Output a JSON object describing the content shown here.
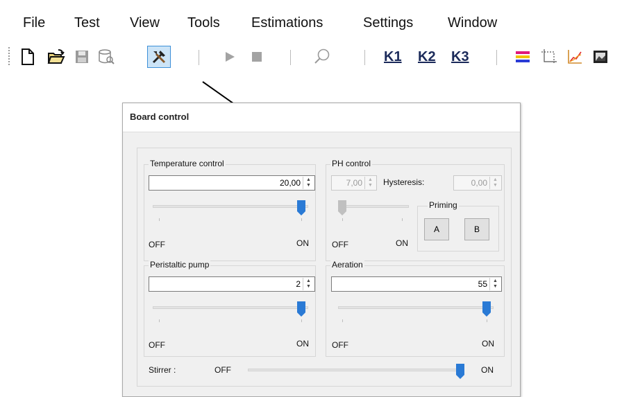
{
  "menu": [
    "File",
    "Test",
    "View",
    "Tools",
    "Estimations",
    "Settings",
    "Window"
  ],
  "toolbar": {
    "icons": [
      "new-file-icon",
      "open-folder-icon",
      "save-icon",
      "database-icon",
      "tools-icon",
      "play-icon",
      "stop-icon",
      "search-icon",
      "color-bars-icon",
      "selection-icon",
      "chart-icon",
      "image-icon"
    ],
    "k_buttons": [
      "K1",
      "K2",
      "K3"
    ]
  },
  "dialog": {
    "title": "Board control",
    "temperature": {
      "label": "Temperature control",
      "value": "20,00",
      "off": "OFF",
      "on": "ON",
      "level": 1.0
    },
    "ph": {
      "label": "PH control",
      "value": "7,00",
      "hysteresis_label": "Hysteresis:",
      "hysteresis_value": "0,00",
      "off": "OFF",
      "on": "ON",
      "level": 0.0
    },
    "priming": {
      "label": "Priming",
      "a": "A",
      "b": "B"
    },
    "pump": {
      "label": "Peristaltic pump",
      "value": "2",
      "off": "OFF",
      "on": "ON",
      "level": 1.0
    },
    "aeration": {
      "label": "Aeration",
      "value": "55",
      "off": "OFF",
      "on": "ON",
      "level": 1.0
    },
    "stirrer": {
      "label": "Stirrer :",
      "off": "OFF",
      "on": "ON",
      "level": 1.0
    }
  },
  "colors": {
    "accent": "#2a7ad5",
    "disabled": "#c0c0c0"
  }
}
